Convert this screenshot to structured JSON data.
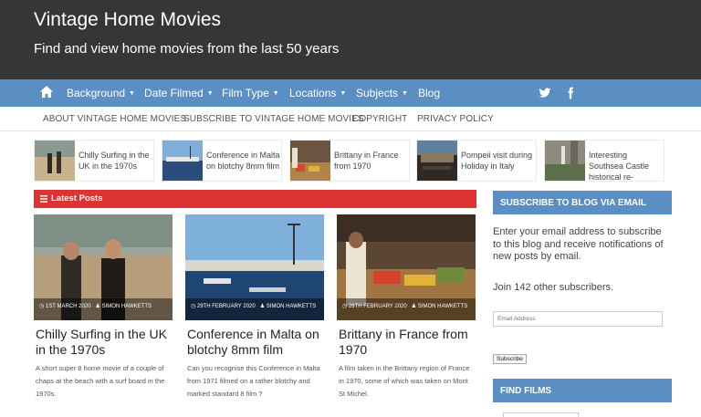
{
  "site": {
    "title": "Vintage Home Movies",
    "tagline": "Find and view home movies from the last 50 years"
  },
  "main_nav": {
    "items": [
      {
        "label": "Background",
        "dropdown": true
      },
      {
        "label": "Date Filmed",
        "dropdown": true
      },
      {
        "label": "Film Type",
        "dropdown": true
      },
      {
        "label": "Locations",
        "dropdown": true
      },
      {
        "label": "Subjects",
        "dropdown": true
      },
      {
        "label": "Blog",
        "dropdown": false
      }
    ],
    "icons": [
      "home-icon",
      "twitter-icon",
      "facebook-icon"
    ]
  },
  "sub_nav": {
    "items": [
      "ABOUT VINTAGE HOME MOVIES",
      "SUBSCRIBE TO VINTAGE HOME MOVIES",
      "COPYRIGHT",
      "PRIVACY POLICY"
    ]
  },
  "slider": {
    "items": [
      {
        "title": "Chilly Surfing in the UK in the 1970s"
      },
      {
        "title": "Conference in Malta on blotchy 8mm film"
      },
      {
        "title": "Brittany in France from 1970"
      },
      {
        "title": "Pompeii visit during Holiday in Italy"
      },
      {
        "title": "Interesting Southsea Castle historical re-"
      }
    ]
  },
  "latest": {
    "label": "Latest Posts",
    "posts": [
      {
        "date": "1ST MARCH 2020",
        "author": "SIMON HAWKETTS",
        "title": "Chilly Surfing in the UK in the 1970s",
        "excerpt": "A short super 8 home movie of a couple of chaps at the beach with a surf board in the 1970s."
      },
      {
        "date": "29TH FEBRUARY 2020",
        "author": "SIMON HAWKETTS",
        "title": "Conference in Malta on blotchy 8mm film",
        "excerpt": "Can you recognise this Conference in Malta from 1971 filmed on a rather blotchy and marked standard 8 film ?"
      },
      {
        "date": "28TH FEBRUARY 2020",
        "author": "SIMON HAWKETTS",
        "title": "Brittany in France from 1970",
        "excerpt": "A film taken in the Brittany region of France in 1970, some of which was taken on Mont St Michel."
      }
    ]
  },
  "sidebar": {
    "subscribe_heading": "SUBSCRIBE TO BLOG VIA EMAIL",
    "subscribe_text": "Enter your email address to subscribe to this blog and receive notifications of new posts by email.",
    "join_text": "Join 142 other subscribers.",
    "email_placeholder": "Email Address",
    "subscribe_button": "Subscribe",
    "find_heading": "FIND FILMS"
  },
  "colors": {
    "header_bg": "#363636",
    "nav_bg": "#5b8ec3",
    "latest_bar": "#dd3333"
  }
}
